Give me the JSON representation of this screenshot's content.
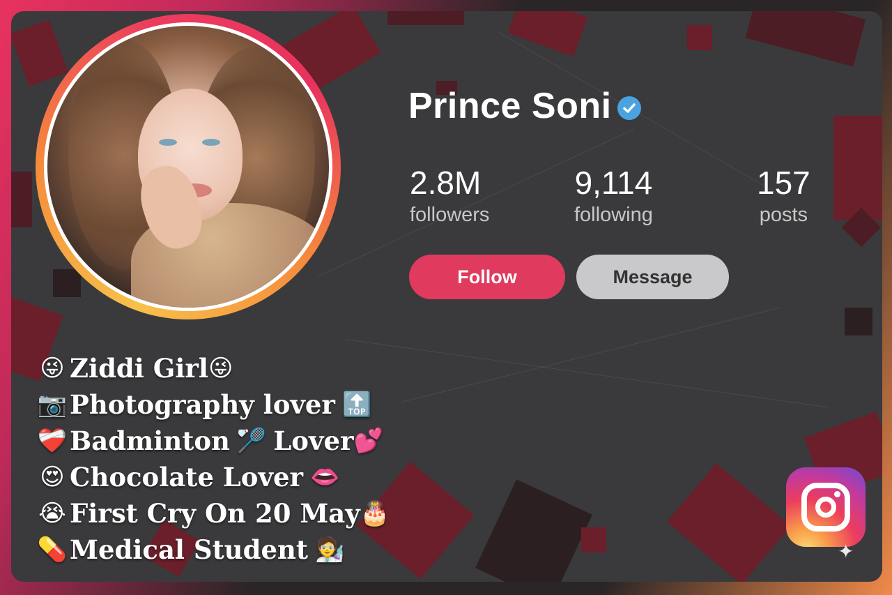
{
  "profile": {
    "name": "Prince Soni",
    "verified": true,
    "stats": [
      {
        "value": "2.8M",
        "label": "followers"
      },
      {
        "value": "9,114",
        "label": "following"
      },
      {
        "value": "157",
        "label": "posts"
      }
    ],
    "buttons": {
      "follow": "Follow",
      "message": "Message"
    }
  },
  "bio": [
    {
      "lead": "😜",
      "text": "Ziddi Girl",
      "tail": "😜"
    },
    {
      "lead": "📷",
      "text": "Photography lover",
      "tail": "🔝"
    },
    {
      "lead": "❤️‍🩹",
      "text": "Badminton",
      "mid": "🏸",
      "text2": "Lover",
      "tail": "💕"
    },
    {
      "lead": "😍",
      "text": "Chocolate Lover",
      "tail": "👄"
    },
    {
      "lead": "😭",
      "text": "First Cry On 20 May",
      "tail": "🎂"
    },
    {
      "lead": "💊",
      "text": "Medical Student",
      "tail": "🧑‍🔬"
    }
  ],
  "colors": {
    "follow_button": "#e03a5e",
    "message_button": "#c9c9cb",
    "card_background": "#3a3a3c",
    "verified_badge": "#4aa3e0"
  },
  "icons": {
    "verified": "verified-check-icon",
    "app": "instagram-logo-icon",
    "corner": "sparkle-icon"
  }
}
